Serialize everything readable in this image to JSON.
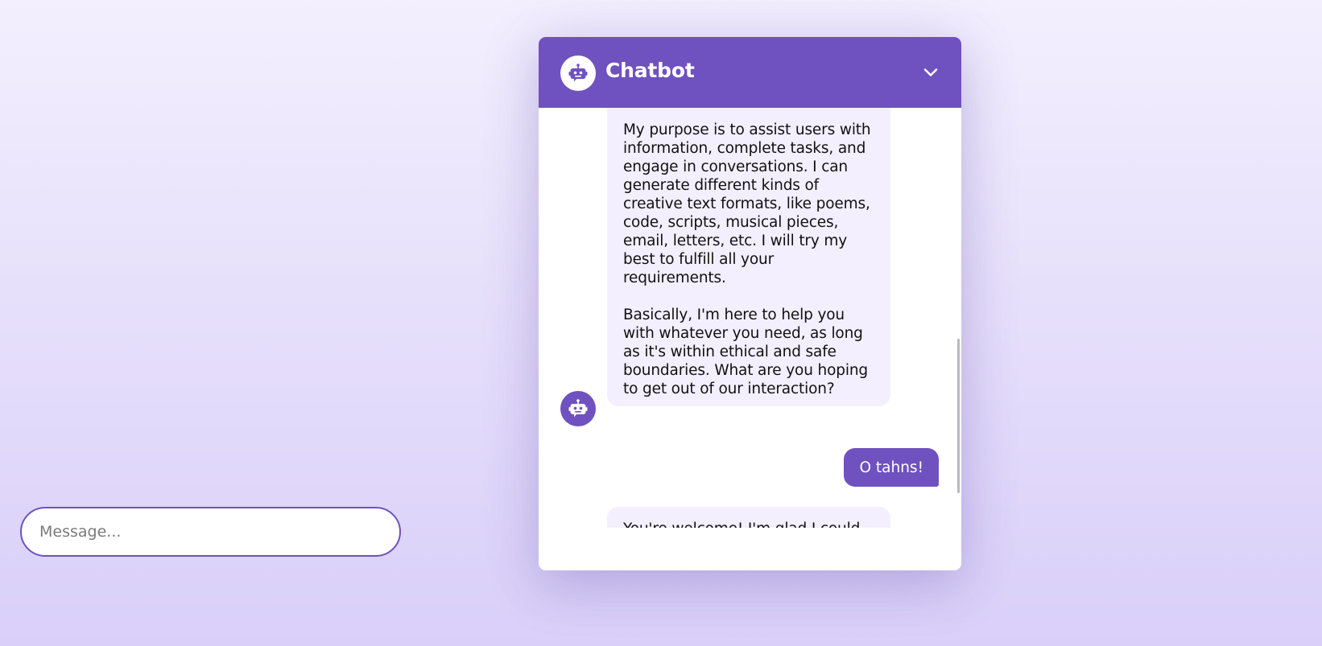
{
  "header": {
    "title": "Chatbot",
    "collapse_icon": "chevron-down-icon",
    "avatar_icon": "robot-icon"
  },
  "messages": [
    {
      "role": "bot",
      "text": "My purpose is to assist users with information, complete tasks, and engage in conversations. I can generate different kinds of creative text formats, like poems, code, scripts, musical pieces, email, letters, etc. I will try my best to fulfill all your requirements.\n\nBasically, I'm here to help you with whatever you need, as long as it's within ethical and safe boundaries. What are you hoping to get out of our interaction?"
    },
    {
      "role": "user",
      "text": "O tahns!"
    },
    {
      "role": "bot",
      "text": "You're welcome! I'm glad I could"
    }
  ],
  "input": {
    "placeholder": "Message...",
    "value": ""
  },
  "colors": {
    "accent": "#6f51c0",
    "bot_bubble": "#f3effe",
    "page_background_top": "#f3effe",
    "page_background_bottom": "#d9cff9"
  }
}
